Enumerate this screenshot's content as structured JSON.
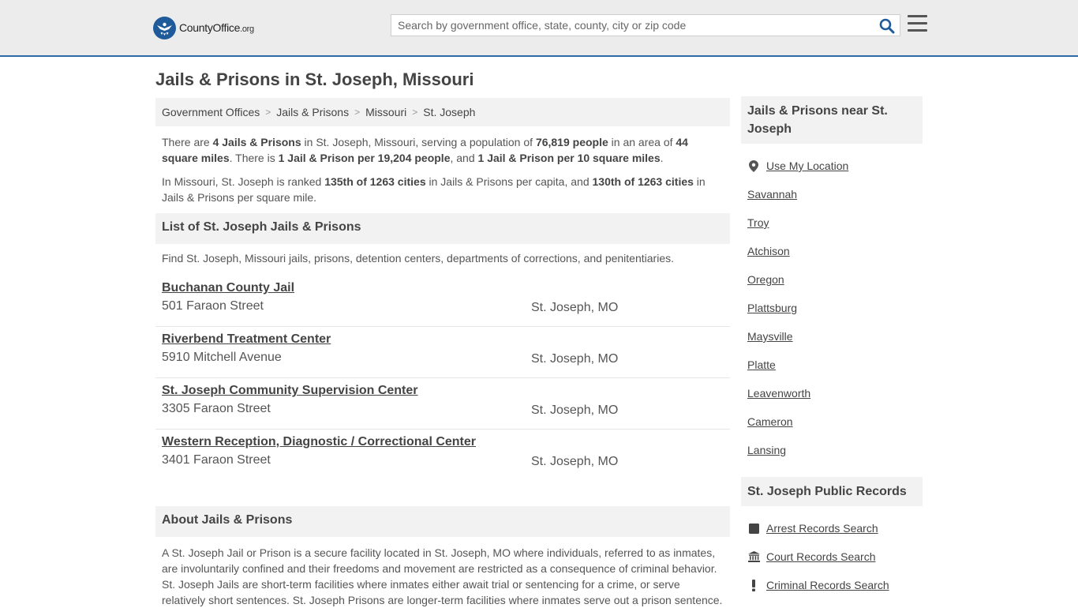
{
  "header": {
    "logo_name": "CountyOffice",
    "logo_tld": ".org",
    "search_placeholder": "Search by government office, state, county, city or zip code"
  },
  "page_title": "Jails & Prisons in St. Joseph, Missouri",
  "breadcrumb": [
    "Government Offices",
    "Jails & Prisons",
    "Missouri",
    "St. Joseph"
  ],
  "intro": {
    "p1_parts": [
      "There are ",
      "4 Jails & Prisons",
      " in St. Joseph, Missouri, serving a population of ",
      "76,819 people",
      " in an area of ",
      "44 square miles",
      ". There is ",
      "1 Jail & Prison per 19,204 people",
      ", and ",
      "1 Jail & Prison per 10 square miles",
      "."
    ],
    "p2_parts": [
      "In Missouri, St. Joseph is ranked ",
      "135th of 1263 cities",
      " in Jails & Prisons per capita, and ",
      "130th of 1263 cities",
      " in Jails & Prisons per square mile."
    ]
  },
  "list_section": {
    "title": "List of St. Joseph Jails & Prisons",
    "description": "Find St. Joseph, Missouri jails, prisons, detention centers, departments of corrections, and penitentiaries."
  },
  "listings": [
    {
      "name": "Buchanan County Jail",
      "address": "501 Faraon Street",
      "city": "St. Joseph, MO"
    },
    {
      "name": "Riverbend Treatment Center",
      "address": "5910 Mitchell Avenue",
      "city": "St. Joseph, MO"
    },
    {
      "name": "St. Joseph Community Supervision Center",
      "address": "3305 Faraon Street",
      "city": "St. Joseph, MO"
    },
    {
      "name": "Western Reception, Diagnostic / Correctional Center",
      "address": "3401 Faraon Street",
      "city": "St. Joseph, MO"
    }
  ],
  "about": {
    "title": "About Jails & Prisons",
    "text": "A St. Joseph Jail or Prison is a secure facility located in St. Joseph, MO where individuals, referred to as inmates, are involuntarily confined and their freedoms and movement are restricted as a consequence of criminal behavior. St. Joseph Jails are short-term facilities where inmates either await trial or sentencing for a crime, or serve relatively short sentences. St. Joseph Prisons are longer-term facilities where inmates serve out a prison sentence."
  },
  "sidebar": {
    "nearby_title": "Jails & Prisons near St. Joseph",
    "use_location": "Use My Location",
    "nearby": [
      "Savannah",
      "Troy",
      "Atchison",
      "Oregon",
      "Plattsburg",
      "Maysville",
      "Platte",
      "Leavenworth",
      "Cameron",
      "Lansing"
    ],
    "records_title": "St. Joseph Public Records",
    "records": [
      {
        "label": "Arrest Records Search",
        "icon": "square-icon"
      },
      {
        "label": "Court Records Search",
        "icon": "courthouse-icon"
      },
      {
        "label": "Criminal Records Search",
        "icon": "exclamation-icon"
      }
    ]
  },
  "colors": {
    "header_bg": "#ececec",
    "header_border": "#2f6aa6",
    "brand_blue": "#1f5b9a",
    "panel_bg": "#f2f2f2"
  }
}
